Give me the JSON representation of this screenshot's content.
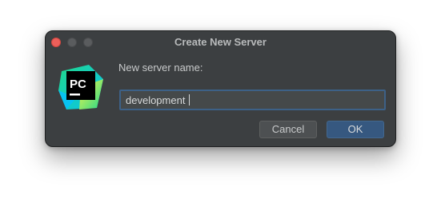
{
  "window": {
    "title": "Create New Server",
    "controls": {
      "close": "close-button",
      "minimize": "minimize-button",
      "maximize": "maximize-button"
    }
  },
  "app_icon": {
    "name": "pycharm-logo",
    "text": "PC"
  },
  "form": {
    "prompt_label": "New server name:",
    "server_name_value": "development"
  },
  "buttons": {
    "cancel_label": "Cancel",
    "ok_label": "OK"
  },
  "colors": {
    "dialog_bg": "#3c3f41",
    "input_bg": "#45494a",
    "focus_border": "#3d6187",
    "ok_bg": "#365880",
    "close_red": "#ec5f5a"
  }
}
